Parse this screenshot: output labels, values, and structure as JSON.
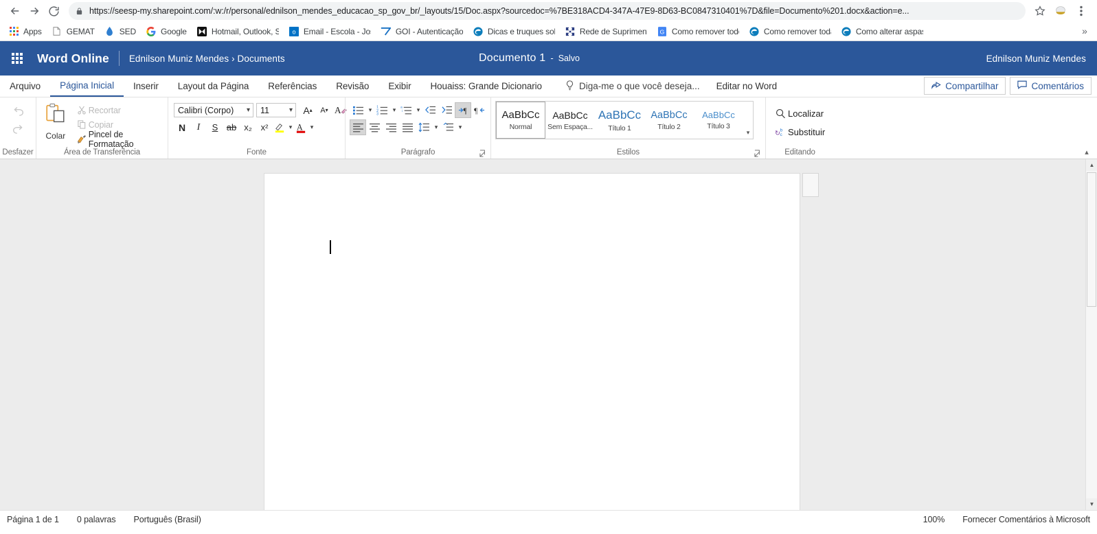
{
  "browser": {
    "back_icon": "back-arrow-icon",
    "forward_icon": "forward-arrow-icon",
    "reload_icon": "reload-icon",
    "lock_icon": "lock-icon",
    "url": "https://seesp-my.sharepoint.com/:w:/r/personal/ednilson_mendes_educacao_sp_gov_br/_layouts/15/Doc.aspx?sourcedoc=%7BE318ACD4-347A-47E9-8D63-BC0847310401%7D&file=Documento%201.docx&action=e...",
    "star_icon": "star-icon",
    "profile_icon": "profile-avatar-icon",
    "menu_icon": "three-dot-menu-icon",
    "bookmarks_overflow": "»",
    "bookmarks": [
      {
        "label": "Apps",
        "icon": "apps-grid-icon"
      },
      {
        "label": "GEMAT",
        "icon": "page-icon"
      },
      {
        "label": "SED",
        "icon": "droplet-icon"
      },
      {
        "label": "Google",
        "icon": "google-g-icon"
      },
      {
        "label": "Hotmail, Outlook, Sk",
        "icon": "outlook-icon"
      },
      {
        "label": "Email - Escola - Jose",
        "icon": "office-mail-icon"
      },
      {
        "label": "GOI - Autenticação",
        "icon": "goi-icon"
      },
      {
        "label": "Dicas e truques sobre",
        "icon": "edge-icon"
      },
      {
        "label": "Rede de Suprimentos",
        "icon": "puzzle-icon"
      },
      {
        "label": "Como remover todos",
        "icon": "google-doc-icon"
      },
      {
        "label": "Como remover todas",
        "icon": "edge-icon"
      },
      {
        "label": "Como alterar aspas n",
        "icon": "edge-icon"
      }
    ]
  },
  "app_header": {
    "waffle_icon": "app-launcher-waffle-icon",
    "brand": "Word Online",
    "breadcrumb": "Ednilson Muniz Mendes › Documents",
    "doc_title": "Documento 1",
    "dash": "-",
    "save_state": "Salvo",
    "user": "Ednilson Muniz Mendes",
    "brand_color": "#2b579a"
  },
  "ribbon_tabs": {
    "tabs": [
      {
        "label": "Arquivo",
        "active": false
      },
      {
        "label": "Página Inicial",
        "active": true
      },
      {
        "label": "Inserir",
        "active": false
      },
      {
        "label": "Layout da Página",
        "active": false
      },
      {
        "label": "Referências",
        "active": false
      },
      {
        "label": "Revisão",
        "active": false
      },
      {
        "label": "Exibir",
        "active": false
      },
      {
        "label": "Houaiss: Grande Dicionario",
        "active": false
      }
    ],
    "tell_me": "Diga-me o que você deseja...",
    "tell_me_icon": "lightbulb-icon",
    "edit_in_word": "Editar no Word",
    "share": "Compartilhar",
    "share_icon": "share-icon",
    "comments": "Comentários",
    "comments_icon": "comment-bubble-icon"
  },
  "ribbon": {
    "undo": {
      "label": "Desfazer",
      "undo_icon": "undo-arrow-icon",
      "redo_icon": "redo-arrow-icon"
    },
    "clipboard": {
      "label": "Área de Transferência",
      "paste": "Colar",
      "paste_icon": "clipboard-paste-icon",
      "items": [
        {
          "label": "Recortar",
          "icon": "scissors-icon",
          "enabled": false
        },
        {
          "label": "Copiar",
          "icon": "copy-pages-icon",
          "enabled": false
        },
        {
          "label": "Pincel de Formatação",
          "icon": "format-painter-brush-icon",
          "enabled": true
        }
      ]
    },
    "font": {
      "label": "Fonte",
      "font_name": "Calibri (Corpo)",
      "font_size": "11",
      "grow_icon": "increase-font-size-icon",
      "shrink_icon": "decrease-font-size-icon",
      "clear_format_icon": "clear-formatting-icon",
      "bold": "N",
      "italic": "I",
      "underline": "S",
      "strike": "ab",
      "subscript": "x₂",
      "superscript": "x²",
      "highlight_icon": "text-highlight-icon",
      "font_color_icon": "font-color-icon",
      "highlight_color": "#ffff00",
      "font_color": "#e00000"
    },
    "paragraph": {
      "label": "Parágrafo",
      "bullets_icon": "bulleted-list-icon",
      "numbering_icon": "numbered-list-icon",
      "multilevel_icon": "multilevel-list-icon",
      "decrease_indent_icon": "decrease-indent-icon",
      "increase_indent_icon": "increase-indent-icon",
      "ltr_icon": "left-to-right-text-icon",
      "rtl_icon": "right-to-left-text-icon",
      "align_left_icon": "align-left-icon",
      "align_center_icon": "align-center-icon",
      "align_right_icon": "align-right-icon",
      "justify_icon": "justify-icon",
      "line_spacing_icon": "line-spacing-icon",
      "paragraph_spacing_icon": "paragraph-spacing-icon"
    },
    "styles": {
      "label": "Estilos",
      "preview_text": "AaBbCc",
      "items": [
        {
          "name": "Normal",
          "selected": true,
          "color": "#1f1f1f",
          "size": 15
        },
        {
          "name": "Sem Espaça...",
          "selected": false,
          "color": "#1f1f1f",
          "size": 14
        },
        {
          "name": "Título 1",
          "selected": false,
          "color": "#2e74b5",
          "size": 17
        },
        {
          "name": "Título 2",
          "selected": false,
          "color": "#2e74b5",
          "size": 14.5
        },
        {
          "name": "Título 3",
          "selected": false,
          "color": "#4a8ecb",
          "size": 13
        }
      ],
      "more_icon": "styles-more-chevron-icon"
    },
    "editing": {
      "label": "Editando",
      "find": "Localizar",
      "find_icon": "magnifier-icon",
      "replace": "Substituir",
      "replace_icon": "replace-icon"
    },
    "collapse_icon": "collapse-ribbon-chevron-icon"
  },
  "document": {
    "caret": "text-cursor",
    "margin_note": "comment-anchor-box"
  },
  "status_bar": {
    "page": "Página 1 de 1",
    "words": "0 palavras",
    "language": "Português (Brasil)",
    "zoom": "100%",
    "feedback": "Fornecer Comentários à Microsoft"
  }
}
